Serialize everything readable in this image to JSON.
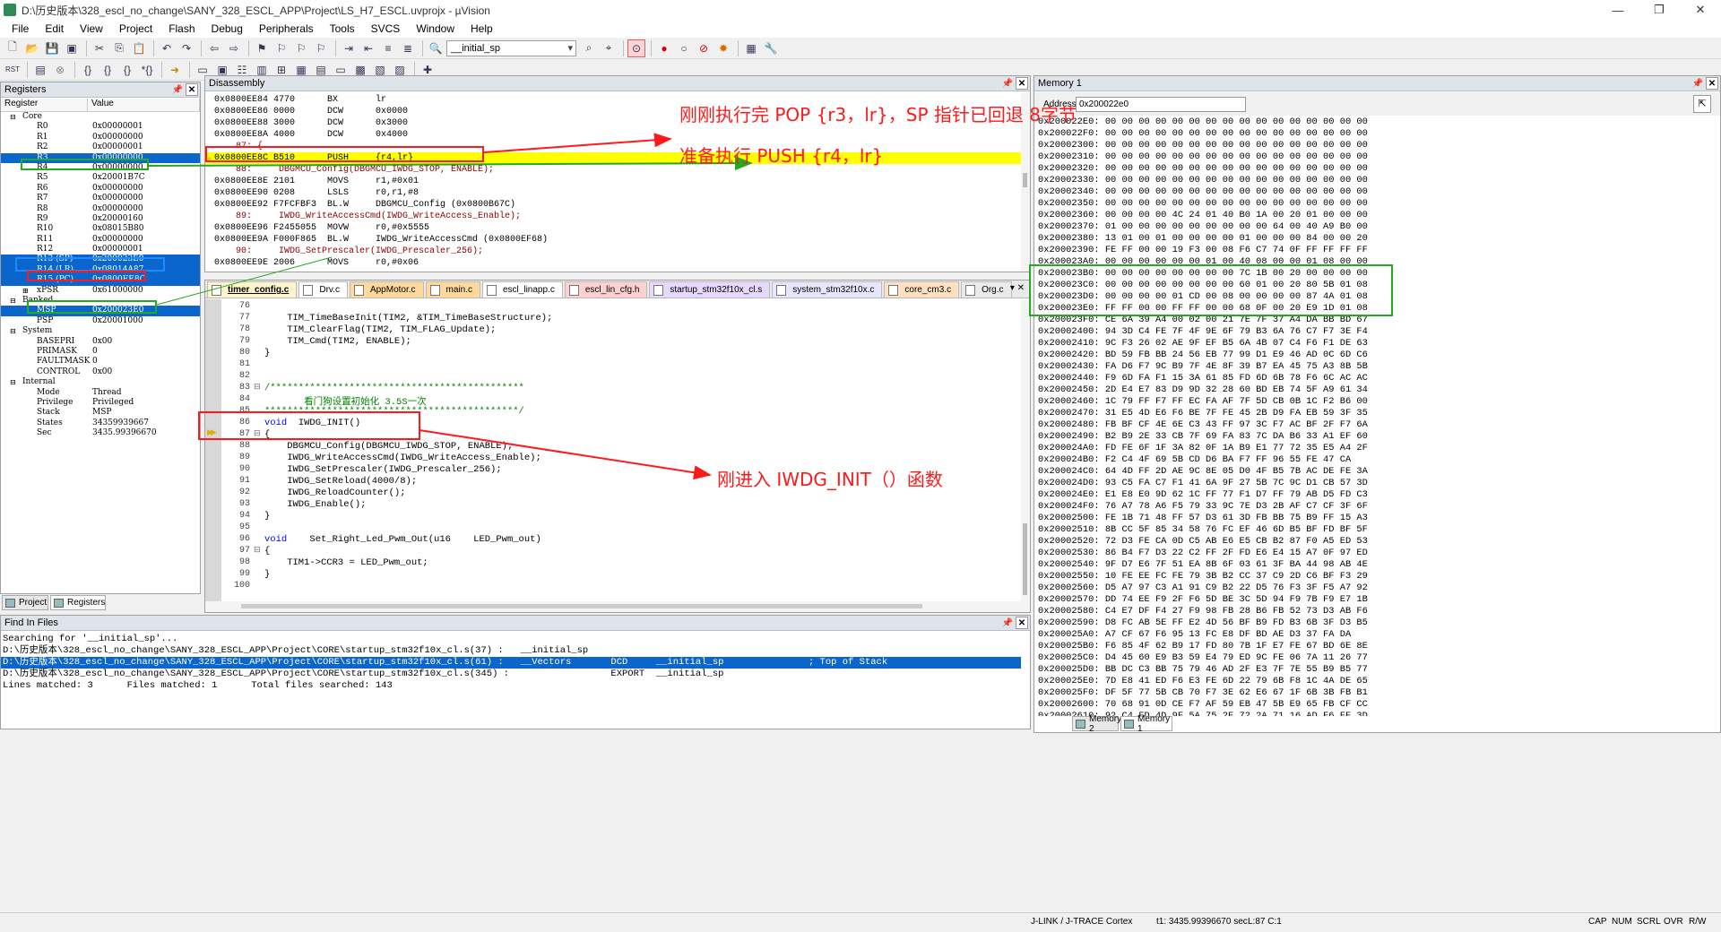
{
  "window": {
    "title": "D:\\历史版本\\328_escl_no_change\\SANY_328_ESCL_APP\\Project\\LS_H7_ESCL.uvprojx - µVision"
  },
  "menu": [
    "File",
    "Edit",
    "View",
    "Project",
    "Flash",
    "Debug",
    "Peripherals",
    "Tools",
    "SVCS",
    "Window",
    "Help"
  ],
  "toolbar": {
    "target_combo": "__initial_sp"
  },
  "registers": {
    "title": "Registers",
    "col_register": "Register",
    "col_value": "Value",
    "groups": {
      "core": "Core",
      "banked": "Banked",
      "system": "System",
      "internal": "Internal"
    },
    "core": [
      {
        "n": "R0",
        "v": "0x00000001"
      },
      {
        "n": "R1",
        "v": "0x00000000"
      },
      {
        "n": "R2",
        "v": "0x00000001"
      },
      {
        "n": "R3",
        "v": "0x00000000"
      },
      {
        "n": "R4",
        "v": "0x00000000"
      },
      {
        "n": "R5",
        "v": "0x20001B7C"
      },
      {
        "n": "R6",
        "v": "0x00000000"
      },
      {
        "n": "R7",
        "v": "0x00000000"
      },
      {
        "n": "R8",
        "v": "0x00000000"
      },
      {
        "n": "R9",
        "v": "0x20000160"
      },
      {
        "n": "R10",
        "v": "0x08015B80"
      },
      {
        "n": "R11",
        "v": "0x00000000"
      },
      {
        "n": "R12",
        "v": "0x00000001"
      },
      {
        "n": "R13 (SP)",
        "v": "0x200023E0"
      },
      {
        "n": "R14 (LR)",
        "v": "0x08014A87"
      },
      {
        "n": "R15 (PC)",
        "v": "0x0800EE8C"
      },
      {
        "n": "xPSR",
        "v": "0x61000000"
      }
    ],
    "banked": [
      {
        "n": "MSP",
        "v": "0x200023E0"
      },
      {
        "n": "PSP",
        "v": "0x20001000"
      }
    ],
    "system": [
      {
        "n": "BASEPRI",
        "v": "0x00"
      },
      {
        "n": "PRIMASK",
        "v": "0"
      },
      {
        "n": "FAULTMASK",
        "v": "0"
      },
      {
        "n": "CONTROL",
        "v": "0x00"
      }
    ],
    "internal": [
      {
        "n": "Mode",
        "v": "Thread"
      },
      {
        "n": "Privilege",
        "v": "Privileged"
      },
      {
        "n": "Stack",
        "v": "MSP"
      },
      {
        "n": "States",
        "v": "34359939667"
      },
      {
        "n": "Sec",
        "v": "3435.99396670"
      }
    ]
  },
  "bottom_tabs": {
    "project": "Project",
    "registers": "Registers"
  },
  "disassembly": {
    "title": "Disassembly",
    "lines": [
      "0x0800EE84 4770      BX       lr",
      "0x0800EE86 0000      DCW      0x0000",
      "0x0800EE88 3000      DCW      0x3000",
      "0x0800EE8A 4000      DCW      0x4000",
      "    87: {",
      "0x0800EE8C B510      PUSH     {r4,lr}",
      "    88:     DBGMCU_Config(DBGMCU_IWDG_STOP, ENABLE);",
      "0x0800EE8E 2101      MOVS     r1,#0x01",
      "0x0800EE90 0208      LSLS     r0,r1,#8",
      "0x0800EE92 F7FCFBF3  BL.W     DBGMCU_Config (0x0800B67C)",
      "    89:     IWDG_WriteAccessCmd(IWDG_WriteAccess_Enable);",
      "0x0800EE96 F2455055  MOVW     r0,#0x5555",
      "0x0800EE9A F000F865  BL.W     IWDG_WriteAccessCmd (0x0800EF68)",
      "    90:     IWDG_SetPrescaler(IWDG_Prescaler_256);",
      "0x0800EE9E 2006      MOVS     r0,#0x06"
    ]
  },
  "editor": {
    "tabs": [
      "timer_config.c",
      "Drv.c",
      "AppMotor.c",
      "main.c",
      "escl_linapp.c",
      "escl_lin_cfg.h",
      "startup_stm32f10x_cl.s",
      "system_stm32f10x.c",
      "core_cm3.c",
      "Org.c"
    ],
    "lines": [
      {
        "n": "76",
        "t": ""
      },
      {
        "n": "77",
        "t": "    TIM_TimeBaseInit(TIM2, &TIM_TimeBaseStructure);"
      },
      {
        "n": "78",
        "t": "    TIM_ClearFlag(TIM2, TIM_FLAG_Update);"
      },
      {
        "n": "79",
        "t": "    TIM_Cmd(TIM2, ENABLE);"
      },
      {
        "n": "80",
        "t": "}"
      },
      {
        "n": "81",
        "t": ""
      },
      {
        "n": "82",
        "t": ""
      },
      {
        "n": "83",
        "t": "/*********************************************"
      },
      {
        "n": "84",
        "t": "       看门狗设置初始化 3.5S一次"
      },
      {
        "n": "85",
        "t": "*********************************************/"
      },
      {
        "n": "86",
        "t": "void  IWDG_INIT()"
      },
      {
        "n": "87",
        "t": "{"
      },
      {
        "n": "88",
        "t": "    DBGMCU_Config(DBGMCU_IWDG_STOP, ENABLE);"
      },
      {
        "n": "89",
        "t": "    IWDG_WriteAccessCmd(IWDG_WriteAccess_Enable);"
      },
      {
        "n": "90",
        "t": "    IWDG_SetPrescaler(IWDG_Prescaler_256);"
      },
      {
        "n": "91",
        "t": "    IWDG_SetReload(4000/8);"
      },
      {
        "n": "92",
        "t": "    IWDG_ReloadCounter();"
      },
      {
        "n": "93",
        "t": "    IWDG_Enable();"
      },
      {
        "n": "94",
        "t": "}"
      },
      {
        "n": "95",
        "t": ""
      },
      {
        "n": "96",
        "t": "void    Set_Right_Led_Pwm_Out(u16    LED_Pwm_out)"
      },
      {
        "n": "97",
        "t": "{"
      },
      {
        "n": "98",
        "t": "    TIM1->CCR3 = LED_Pwm_out;"
      },
      {
        "n": "99",
        "t": "}"
      },
      {
        "n": "100",
        "t": ""
      }
    ]
  },
  "find": {
    "title": "Find In Files",
    "lines": [
      "Searching for '__initial_sp'...",
      "D:\\历史版本\\328_escl_no_change\\SANY_328_ESCL_APP\\Project\\CORE\\startup_stm32f10x_cl.s(37) :   __initial_sp",
      "D:\\历史版本\\328_escl_no_change\\SANY_328_ESCL_APP\\Project\\CORE\\startup_stm32f10x_cl.s(61) :   __Vectors       DCD     __initial_sp               ; Top of Stack",
      "D:\\历史版本\\328_escl_no_change\\SANY_328_ESCL_APP\\Project\\CORE\\startup_stm32f10x_cl.s(345) :                  EXPORT  __initial_sp",
      "Lines matched: 3      Files matched: 1      Total files searched: 143"
    ]
  },
  "memory": {
    "title": "Memory 1",
    "address_label": "Address:",
    "address_value": "0x200022e0",
    "rows": [
      "0x200022E0: 00 00 00 00 00 00 00 00 00 00 00 00 00 00 00 00",
      "0x200022F0: 00 00 00 00 00 00 00 00 00 00 00 00 00 00 00 00",
      "0x20002300: 00 00 00 00 00 00 00 00 00 00 00 00 00 00 00 00",
      "0x20002310: 00 00 00 00 00 00 00 00 00 00 00 00 00 00 00 00",
      "0x20002320: 00 00 00 00 00 00 00 00 00 00 00 00 00 00 00 00",
      "0x20002330: 00 00 00 00 00 00 00 00 00 00 00 00 00 00 00 00",
      "0x20002340: 00 00 00 00 00 00 00 00 00 00 00 00 00 00 00 00",
      "0x20002350: 00 00 00 00 00 00 00 00 00 00 00 00 00 00 00 00",
      "0x20002360: 00 00 00 00 4C 24 01 40 B0 1A 00 20 01 00 00 00",
      "0x20002370: 01 00 00 00 00 00 00 00 00 00 64 00 40 A9 B0 00",
      "0x20002380: 13 01 00 01 00 00 00 00 01 00 00 00 84 00 00 20",
      "0x20002390: FE FF 00 00 19 F3 00 08 F6 C7 74 0F FF FF FF FF",
      "0x200023A0: 00 00 00 00 00 00 01 00 40 08 00 00 01 08 00 00",
      "0x200023B0: 00 00 00 00 00 00 00 00 7C 1B 00 20 00 00 00 00",
      "0x200023C0: 00 00 00 00 00 00 00 00 60 01 00 20 80 5B 01 08",
      "0x200023D0: 00 00 00 00 01 CD 00 08 00 00 00 00 87 4A 01 08",
      "0x200023E0: FF FF 00 00 FF FF 00 00 68 0F 00 20 E9 1D 01 08",
      "0x200023F0: CE 6A 39 A4 00 02 00 21 7E 7F 37 A4 DA BB BD 67",
      "0x20002400: 94 3D C4 FE 7F 4F 9E 6F 79 B3 6A 76 C7 F7 3E F4",
      "0x20002410: 9C F3 26 02 AE 9F EF B5 6A 4B 07 C4 F6 F1 DE 63",
      "0x20002420: BD 59 FB BB 24 56 EB 77 99 D1 E9 46 AD 0C 6D C6",
      "0x20002430: FA D6 F7 9C B9 7F 4E 8F 39 B7 EA 45 75 A3 8B 5B",
      "0x20002440: F9 6D FA F1 15 3A 61 85 FD 6D 6B 78 F6 6C AC AC",
      "0x20002450: 2D E4 E7 83 D9 9D 32 28 60 BD EB 74 5F A9 61 34",
      "0x20002460: 1C 79 FF F7 FF EC FA AF 7F 5D CB 0B 1C F2 B6 00",
      "0x20002470: 31 E5 4D E6 F6 BE 7F FE 45 2B D9 FA EB 59 3F 35",
      "0x20002480: FB BF CF 4E 6E C3 43 FF 97 3C F7 AC BF 2F F7 6A",
      "0x20002490: B2 B9 2E 33 CB 7F 69 FA 83 7C DA B6 33 A1 EF 60",
      "0x200024A0: FD FE 6F 1F 3A 82 0F 1A B9 E1 77 72 35 E5 A4 2F",
      "0x200024B0: F2 C4 4F 69 5B CD D6 BA F7 FF 96 55 FE 47 CA",
      "0x200024C0: 64 4D FF 2D AE 9C 8E 05 D0 4F B5 7B AC DE FE 3A",
      "0x200024D0: 93 C5 FA C7 F1 41 6A 9F 27 5B 7C 9C D1 CB 57 3D",
      "0x200024E0: E1 E8 E0 9D 62 1C FF 77 F1 D7 FF 79 AB D5 FD C3",
      "0x200024F0: 76 A7 78 A6 F5 79 33 9C 7E D3 2B AF C7 CF 3F 6F",
      "0x20002500: FE 1B 71 48 FF 57 D3 61 3D FB BB 75 B9 FF 15 A3",
      "0x20002510: 8B CC 5F 85 34 58 76 FC EF 46 6D B5 BF FD BF 5F",
      "0x20002520: 72 D3 FE CA 0D C5 AB E6 E5 CB B2 87 F0 A5 ED 53",
      "0x20002530: 86 B4 F7 D3 22 C2 FF 2F FD E6 E4 15 A7 0F 97 ED",
      "0x20002540: 9F D7 E6 7F 51 EA 8B 6F 03 61 3F BA 44 98 AB 4E",
      "0x20002550: 10 FE EE FC FE 79 3B B2 CC 37 C9 2D C6 BF F3 29",
      "0x20002560: D5 A7 97 C3 A1 91 C9 B2 22 D5 76 F3 3F F5 A7 92",
      "0x20002570: DD 74 EE F9 2F F6 5D BE 3C 5D 94 F9 7B F9 E7 1B",
      "0x20002580: C4 E7 DF F4 27 F9 98 FB 28 B6 FB 52 73 D3 AB F6",
      "0x20002590: D8 FC AB 5E FF E2 4D 56 BF B9 FD B3 6B 3F D3 B5",
      "0x200025A0: A7 CF 67 F6 95 13 FC E8 DF BD AE D3 37 FA DA",
      "0x200025B0: F6 85 4F 62 B9 17 FD 80 7B 1F E7 FE 67 BD 6E 8E",
      "0x200025C0: D4 45 60 E9 B3 59 E4 79 ED 9C FE 06 7A 11 26 77",
      "0x200025D0: BB DC C3 BB 75 79 46 AD 2F E3 7F 7E 55 B9 B5 77",
      "0x200025E0: 7D E8 41 ED F6 E3 FE 6D 22 79 6B F8 1C 4A DE 65",
      "0x200025F0: DF 5F 77 5B CB 70 F7 3E 62 E6 67 1F 6B 3B FB B1",
      "0x20002600: 70 68 91 0D CE F7 AF 59 EB 47 5B E9 65 FB CF CC",
      "0x20002610: 92 C4 FD 4D 9F 5A 75 2F 72 2A 71 16 AD F6 FF 3D"
    ],
    "tab2": "Memory 2",
    "tab1": "Memory 1"
  },
  "status": {
    "jlink": "J-LINK / J-TRACE Cortex",
    "time": "t1: 3435.99396670 sec",
    "pos": "L:87 C:1",
    "caps": "CAP",
    "num": "NUM",
    "scrl": "SCRL",
    "ovr": "OVR",
    "rw": "R/W"
  },
  "annotations": {
    "pop": "刚刚执行完 POP {r3，lr}，SP 指针已回退 8字节",
    "push": "准备执行 PUSH {r4，lr}",
    "enter": "刚进入 IWDG_INIT（）函数"
  },
  "colors": {
    "red": "#ff1a1a",
    "green": "#22aa22",
    "blue": "#1a8cff",
    "selection": "#0a66cc",
    "current_line": "#ffff00"
  }
}
